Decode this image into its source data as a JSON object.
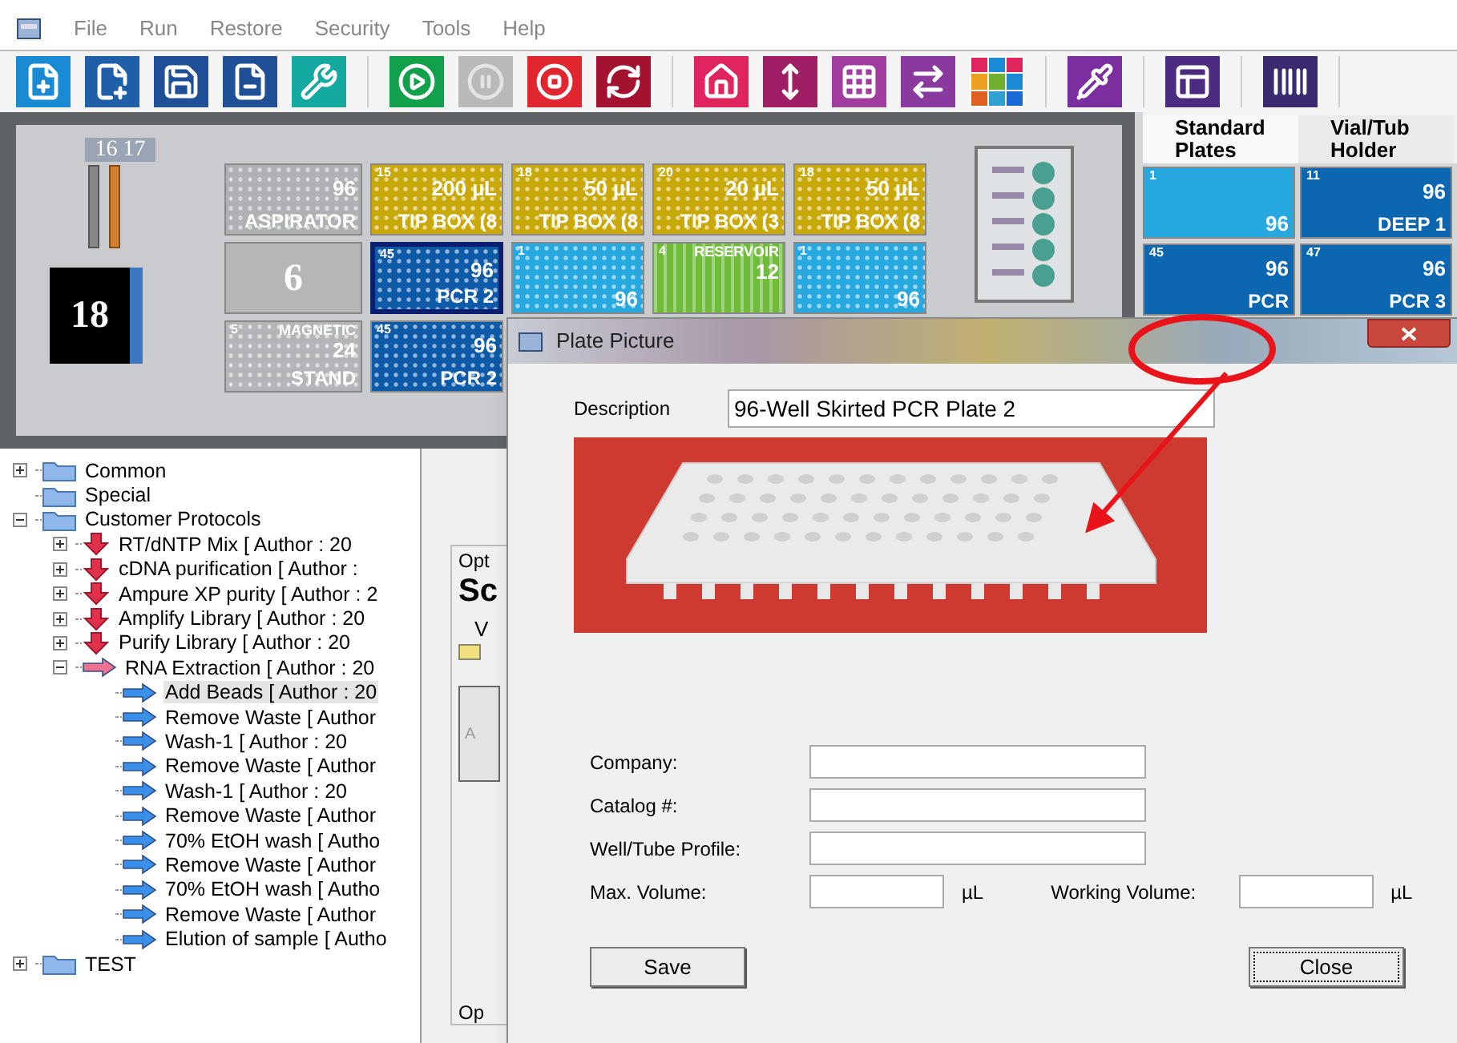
{
  "menu": {
    "items": [
      "File",
      "Run",
      "Restore",
      "Security",
      "Tools",
      "Help"
    ]
  },
  "toolbar": [
    [
      {
        "kind": "new-file",
        "color": "#1a8ad4",
        "disabled": false
      },
      {
        "kind": "new-document",
        "color": "#1f5fa8",
        "disabled": false
      },
      {
        "kind": "save",
        "color": "#1f4f96",
        "disabled": false
      },
      {
        "kind": "remove-file",
        "color": "#1f4f96",
        "disabled": false
      },
      {
        "kind": "tools",
        "color": "#13a8a0",
        "disabled": false
      }
    ],
    [
      {
        "kind": "run",
        "color": "#13a04a",
        "disabled": false
      },
      {
        "kind": "pause",
        "color": "#b9b9b9",
        "disabled": true
      },
      {
        "kind": "stop",
        "color": "#e0262e",
        "disabled": false
      },
      {
        "kind": "refresh",
        "color": "#a3122e",
        "disabled": false
      }
    ],
    [
      {
        "kind": "home",
        "color": "#e0245e",
        "disabled": false
      },
      {
        "kind": "height",
        "color": "#9e1f63",
        "disabled": false
      },
      {
        "kind": "grid",
        "color": "#a03d9e",
        "disabled": false
      },
      {
        "kind": "tip-transfer",
        "color": "#8a3a9e",
        "disabled": false
      },
      {
        "kind": "palette",
        "color": "#ffffff",
        "disabled": false
      }
    ],
    [
      {
        "kind": "tip",
        "color": "#7b2e9e",
        "disabled": false
      }
    ],
    [
      {
        "kind": "layout",
        "color": "#4b2b80",
        "disabled": false
      }
    ],
    [
      {
        "kind": "barcode",
        "color": "#3a2a70",
        "disabled": false
      }
    ]
  ],
  "deck": {
    "rack_label": "16 17",
    "position_label": "18",
    "rows": [
      [
        {
          "kind": "plate",
          "count": "96",
          "label": "ASPIRATOR",
          "color": "#aeb0b3",
          "selected": false
        },
        {
          "kind": "plate",
          "number": "15",
          "count": "200 µL",
          "label": "TIP BOX (8",
          "color": "#c9a90a",
          "selected": false
        },
        {
          "kind": "plate",
          "number": "18",
          "count": "50 µL",
          "label": "TIP BOX (8",
          "color": "#c9a90a",
          "selected": false
        },
        {
          "kind": "plate",
          "number": "20",
          "count": "20 µL",
          "label": "TIP BOX (3",
          "color": "#c9a90a",
          "selected": false
        },
        {
          "kind": "plate",
          "number": "18",
          "count": "50 µL",
          "label": "TIP BOX (8",
          "color": "#c9a90a",
          "selected": false
        }
      ],
      [
        {
          "kind": "slot",
          "label": "6",
          "color": "#b5b6b8",
          "selected": false
        },
        {
          "kind": "plate",
          "number": "45",
          "count": "96",
          "label": "PCR 2",
          "color": "#0c5aa8",
          "selected": true
        },
        {
          "kind": "plate",
          "number": "1",
          "count": "96",
          "color": "#27a9e0",
          "selected": false
        },
        {
          "kind": "reservoir",
          "number": "4",
          "header": "RESERVOIR",
          "count": "12",
          "color": "#6fbb3a",
          "selected": false
        },
        {
          "kind": "plate",
          "number": "1",
          "count": "96",
          "color": "#27a9e0",
          "selected": false
        }
      ],
      [
        {
          "kind": "plate",
          "number": "5",
          "header": "MAGNETIC",
          "count": "24",
          "label": "STAND",
          "color": "#b3b5b8",
          "selected": false
        },
        {
          "kind": "plate",
          "number": "45",
          "count": "96",
          "label": "PCR 2",
          "color": "#0c5aa8",
          "selected": false
        }
      ]
    ]
  },
  "labware_panel": {
    "tabs": [
      {
        "label": "Standard Plates",
        "selected": true
      },
      {
        "label": "Vial/Tub Holder",
        "selected": false
      }
    ],
    "tiles": [
      {
        "number": "1",
        "count": "96",
        "color": "#27a9e0"
      },
      {
        "number": "11",
        "count": "96",
        "label": "DEEP 1",
        "color": "#0c66b0"
      },
      {
        "number": "45",
        "count": "96",
        "label": "PCR",
        "color": "#0c66b0"
      },
      {
        "number": "47",
        "count": "96",
        "label": "PCR 3",
        "color": "#0c66b0"
      }
    ]
  },
  "tree": [
    {
      "label": "Common",
      "kind": "folder",
      "expanded": false,
      "selected": false
    },
    {
      "label": "Special",
      "kind": "folder",
      "selected": false
    },
    {
      "label": "Customer Protocols",
      "kind": "folder",
      "expanded": true,
      "selected": false,
      "children": [
        {
          "label": "RT/dNTP Mix [ Author : 20",
          "kind": "protocol",
          "expanded": false,
          "selected": false
        },
        {
          "label": "cDNA purification [ Author :",
          "kind": "protocol",
          "expanded": false,
          "selected": false
        },
        {
          "label": "Ampure XP purity [ Author : 2",
          "kind": "protocol",
          "expanded": false,
          "selected": false
        },
        {
          "label": "Amplify Library [ Author : 20",
          "kind": "protocol",
          "expanded": false,
          "selected": false
        },
        {
          "label": "Purify Library [ Author : 20",
          "kind": "protocol",
          "expanded": false,
          "selected": false
        },
        {
          "label": "RNA Extraction [ Author : 20",
          "kind": "protocol",
          "expanded": true,
          "selected": false,
          "children": [
            {
              "label": "Add Beads [ Author : 20",
              "kind": "step",
              "selected": true
            },
            {
              "label": "Remove Waste [ Author",
              "kind": "step",
              "selected": false
            },
            {
              "label": "Wash-1 [ Author : 20",
              "kind": "step",
              "selected": false
            },
            {
              "label": "Remove Waste [ Author",
              "kind": "step",
              "selected": false
            },
            {
              "label": "Wash-1 [ Author : 20",
              "kind": "step",
              "selected": false
            },
            {
              "label": "Remove Waste [ Author",
              "kind": "step",
              "selected": false
            },
            {
              "label": "70% EtOH wash [ Autho",
              "kind": "step",
              "selected": false
            },
            {
              "label": "Remove Waste [ Author",
              "kind": "step",
              "selected": false
            },
            {
              "label": "70% EtOH wash [ Autho",
              "kind": "step",
              "selected": false
            },
            {
              "label": "Remove Waste [ Author",
              "kind": "step",
              "selected": false
            },
            {
              "label": "Elution of sample [ Autho",
              "kind": "step",
              "selected": false
            }
          ]
        }
      ]
    },
    {
      "label": "TEST",
      "kind": "folder",
      "expanded": false,
      "selected": false
    }
  ],
  "background_panel": {
    "group_label": "Opt",
    "heading": "Sc",
    "field_label": "V",
    "tab_label": "A",
    "lower_group_label": "Op"
  },
  "dialog": {
    "title": "Plate Picture",
    "description": {
      "label": "Description",
      "value": "96-Well Skirted PCR Plate 2"
    },
    "fields": [
      {
        "label": "Company:"
      },
      {
        "label": "Catalog #:"
      },
      {
        "label": "Well/Tube Profile:"
      }
    ],
    "volumes": [
      {
        "label": "Max. Volume:",
        "unit": "µL"
      },
      {
        "label": "Working Volume:",
        "unit": "µL"
      }
    ],
    "buttons": [
      {
        "label": "Save",
        "focused": false
      },
      {
        "label": "Close",
        "focused": true
      }
    ]
  }
}
